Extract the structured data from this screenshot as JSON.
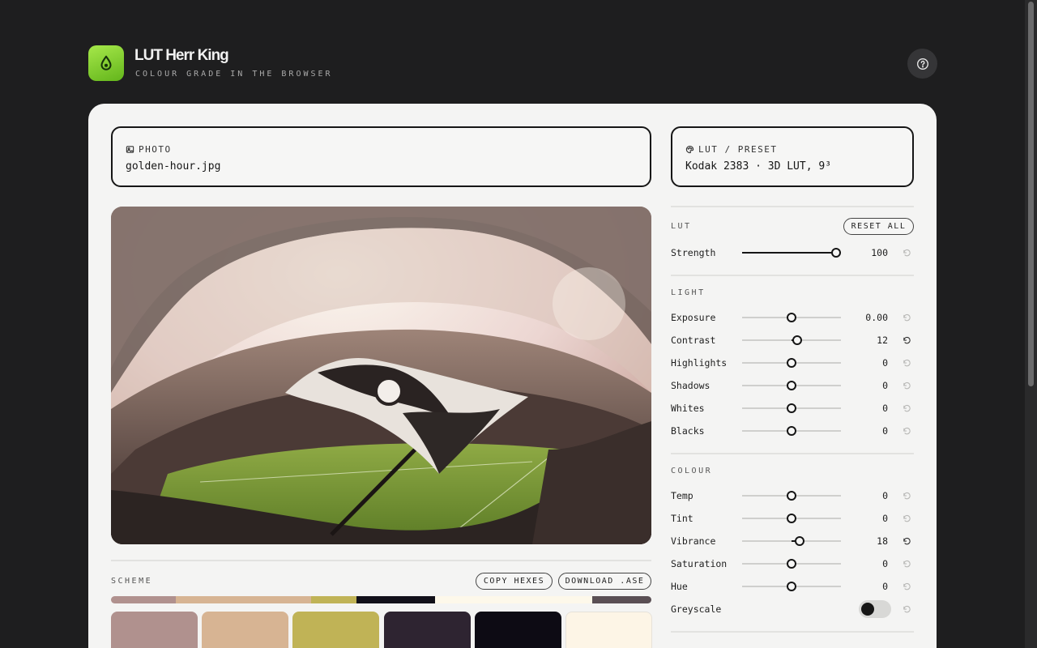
{
  "header": {
    "title": "LUT Herr King",
    "subtitle": "COLOUR GRADE IN THE BROWSER"
  },
  "inputs": {
    "photo": {
      "label": "PHOTO",
      "value": "golden-hour.jpg"
    },
    "lut": {
      "label": "LUT / PRESET",
      "value": "Kodak 2383 · 3D LUT, 9³"
    }
  },
  "lut_section": {
    "title": "LUT",
    "reset_all": "RESET ALL",
    "strength": {
      "label": "Strength",
      "value": "100",
      "level": 0.95
    }
  },
  "light_section": {
    "title": "LIGHT",
    "rows": [
      {
        "label": "Exposure",
        "value": "0.00",
        "level": 0.5
      },
      {
        "label": "Contrast",
        "value": "12",
        "level": 0.555
      },
      {
        "label": "Highlights",
        "value": "0",
        "level": 0.5
      },
      {
        "label": "Shadows",
        "value": "0",
        "level": 0.5
      },
      {
        "label": "Whites",
        "value": "0",
        "level": 0.5
      },
      {
        "label": "Blacks",
        "value": "0",
        "level": 0.5
      }
    ]
  },
  "colour_section": {
    "title": "COLOUR",
    "rows": [
      {
        "label": "Temp",
        "value": "0",
        "level": 0.5
      },
      {
        "label": "Tint",
        "value": "0",
        "level": 0.5
      },
      {
        "label": "Vibrance",
        "value": "18",
        "level": 0.58
      },
      {
        "label": "Saturation",
        "value": "0",
        "level": 0.5
      },
      {
        "label": "Hue",
        "value": "0",
        "level": 0.5
      }
    ],
    "greyscale": {
      "label": "Greyscale",
      "on": false
    }
  },
  "scheme": {
    "title": "SCHEME",
    "copy_button": "COPY HEXES",
    "download_button": "DOWNLOAD .ASE",
    "bar": [
      {
        "color": "#b0918e",
        "share": 0.12
      },
      {
        "color": "#d7b493",
        "share": 0.25
      },
      {
        "color": "#c0b356",
        "share": 0.085
      },
      {
        "color": "#111019",
        "share": 0.145
      },
      {
        "color": "#fdf8ea",
        "share": 0.29
      },
      {
        "color": "#5a4f54",
        "share": 0.11
      }
    ],
    "swatches": [
      "#b0918e",
      "#d7b493",
      "#c0b356",
      "#2e2431",
      "#0d0b14",
      "#fdf5e6"
    ]
  },
  "colors": {
    "accent": "#7ccb2c",
    "ink": "#161616",
    "background": "#1e1e1f",
    "card": "#f4f4f3"
  }
}
